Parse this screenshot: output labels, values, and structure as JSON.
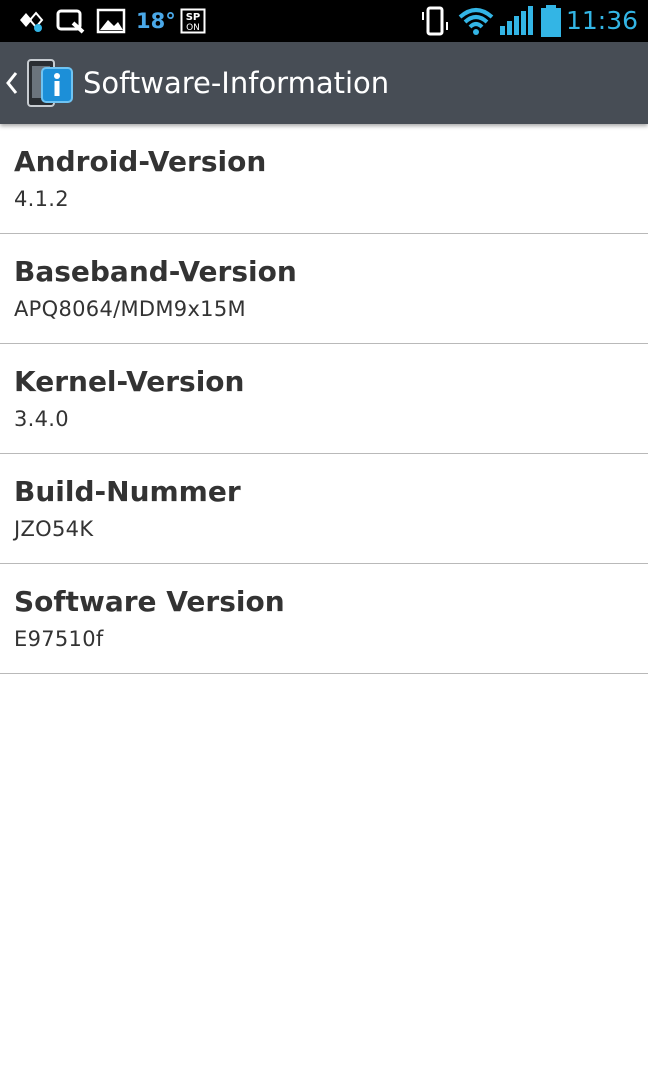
{
  "status_bar": {
    "temperature": "18°",
    "time": "11:36",
    "icons": [
      "smartcard-icon",
      "search-icon",
      "image-icon",
      "sp-on-icon",
      "vibrate-icon",
      "wifi-icon",
      "signal-icon",
      "battery-icon"
    ],
    "sp_badge_top": "SP",
    "sp_badge_bottom": "ON",
    "accent_color": "#33b5e5"
  },
  "action_bar": {
    "title": "Software-Information",
    "background_color": "#474d55"
  },
  "items": [
    {
      "title": "Android-Version",
      "value": "4.1.2"
    },
    {
      "title": "Baseband-Version",
      "value": "APQ8064/MDM9x15M"
    },
    {
      "title": "Kernel-Version",
      "value": "3.4.0"
    },
    {
      "title": "Build-Nummer",
      "value": "JZO54K"
    },
    {
      "title": "Software Version",
      "value": "E97510f"
    }
  ]
}
